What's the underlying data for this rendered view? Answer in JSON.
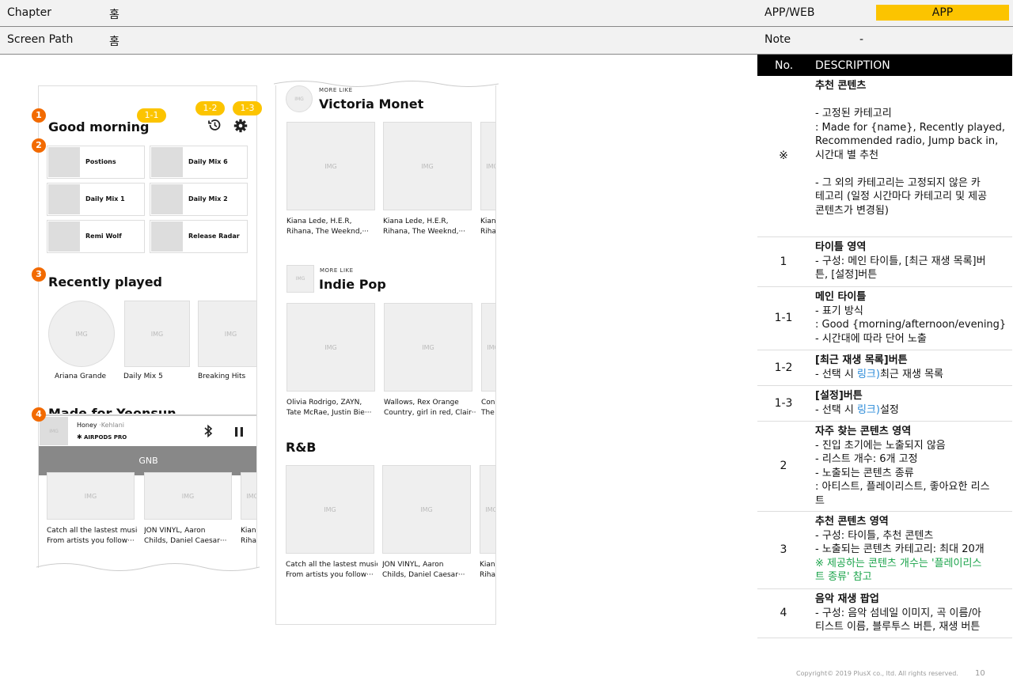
{
  "header": {
    "chapter_label": "Chapter",
    "chapter_value": "홈",
    "app_web_label": "APP/WEB",
    "app_web_value": "APP",
    "screen_path_label": "Screen Path",
    "screen_path_value": "홈",
    "note_label": "Note",
    "note_value": "-"
  },
  "left_screen": {
    "greeting": "Good morning",
    "markers": [
      "1",
      "2",
      "3",
      "4"
    ],
    "tags": [
      "1-1",
      "1-2",
      "1-3"
    ],
    "tiles": [
      "Postions",
      "Daily Mix 6",
      "Daily Mix 1",
      "Daily Mix 2",
      "Remi Wolf",
      "Release Radar"
    ],
    "tile_img": "IMG",
    "recently_title": "Recently played",
    "recent_items": [
      {
        "img": "IMG",
        "label": "Ariana Grande"
      },
      {
        "img": "IMG",
        "label": "Daily Mix 5"
      },
      {
        "img": "IMG",
        "label": "Breaking Hits"
      }
    ],
    "made_for_title": "Made for Yeonsun",
    "player": {
      "img": "IMG",
      "song": "Honey",
      "artist": "·Kehlani",
      "device": "AIRPODS PRO"
    },
    "gnb": "GNB",
    "bottom_items": [
      {
        "img": "IMG",
        "line1": "Catch all the lastest music",
        "line2": "From artists you follow···"
      },
      {
        "img": "IMG",
        "line1": "JON VINYL, Aaron",
        "line2": "Childs, Daniel Caesar···"
      },
      {
        "img": "IMG",
        "line1": "Kiana",
        "line2": "Rihan"
      }
    ]
  },
  "right_screen": {
    "section1": {
      "kicker": "MORE LIKE",
      "title": "Victoria Monet",
      "img": "IMG",
      "items": [
        {
          "img": "IMG",
          "line1": "Kiana Lede, H.E.R,",
          "line2": "Rihana, The Weeknd,···"
        },
        {
          "img": "IMG",
          "line1": "Kiana Lede, H.E.R,",
          "line2": "Rihana, The Weeknd,···"
        },
        {
          "img": "IMG",
          "line1": "Kian",
          "line2": "Riha"
        }
      ]
    },
    "section2": {
      "kicker": "MORE LIKE",
      "title": "Indie Pop",
      "img": "IMG",
      "items": [
        {
          "img": "IMG",
          "line1": "Olivia Rodrigo, ZAYN,",
          "line2": "Tate McRae, Justin Bie···"
        },
        {
          "img": "IMG",
          "line1": "Wallows, Rex Orange",
          "line2": "Country, girl in red, Clair···"
        },
        {
          "img": "IMG",
          "line1": "Cona",
          "line2": "The I"
        }
      ]
    },
    "section3": {
      "title": "R&B",
      "items": [
        {
          "img": "IMG",
          "line1": "Catch all the lastest music",
          "line2": "From artists you follow···"
        },
        {
          "img": "IMG",
          "line1": "JON VINYL, Aaron",
          "line2": "Childs, Daniel Caesar···"
        },
        {
          "img": "IMG",
          "line1": "Kiana",
          "line2": "Rihar"
        }
      ]
    }
  },
  "description": {
    "col_no": "No.",
    "col_desc": "DESCRIPTION",
    "rows": [
      {
        "no": "※",
        "lines": [
          "추천 콘텐츠",
          "",
          "- 고정된 카테고리",
          ": Made for {name}, Recently played,",
          "Recommended radio, Jump back in,",
          "시간대 별 추천",
          "",
          "- 그 외의 카테고리는 고정되지 않은 카",
          "테고리 (일정 시간마다 카테고리 및 제공",
          "콘텐츠가 변경됨)"
        ]
      },
      {
        "no": "1",
        "lines": [
          "타이틀 영역",
          "- 구성: 메인 타이틀, [최근 재생 목록]버",
          "튼, [설정]버튼"
        ]
      },
      {
        "no": "1-1",
        "lines": [
          "메인 타이틀",
          "- 표기 방식",
          ": Good {morning/afternoon/evening}",
          "-  시간대에 따라 단어 노출"
        ]
      },
      {
        "no": "1-2",
        "lines": [
          "[최근 재생 목록]버튼"
        ],
        "link_pre": "- 선택 시 ",
        "link": "링크)",
        "link_post": "최근 재생 목록"
      },
      {
        "no": "1-3",
        "lines": [
          "[설정]버튼"
        ],
        "link_pre": "- 선택 시 ",
        "link": "링크)",
        "link_post": "설정"
      },
      {
        "no": "2",
        "lines": [
          "자주 찾는 콘텐츠 영역",
          "- 진입 초기에는 노출되지 않음",
          "- 리스트 개수: 6개 고정",
          "- 노출되는 콘텐츠 종류",
          ": 아티스트, 플레이리스트, 좋아요한 리스",
          "트"
        ]
      },
      {
        "no": "3",
        "lines": [
          "추천 콘텐츠 영역",
          "- 구성: 타이틀, 추천 콘텐츠",
          "- 노출되는 콘텐츠 카테고리: 최대 20개"
        ],
        "green": [
          "※ 제공하는 콘텐츠 개수는 '플레이리스",
          "트 종류' 참고"
        ]
      },
      {
        "no": "4",
        "lines": [
          "음악 재생 팝업",
          "- 구성: 음악 섬네일 이미지, 곡 이름/아",
          "티스트 이름, 블루투스 버튼, 재생 버튼"
        ]
      }
    ]
  },
  "footer": {
    "copyright": "Copyright© 2019 PlusX co., ltd. All rights reserved.",
    "page": "10"
  }
}
